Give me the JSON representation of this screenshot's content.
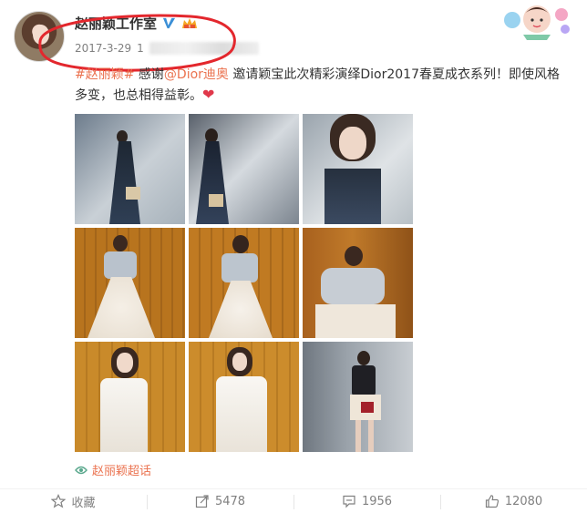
{
  "post": {
    "author": "赵丽颖工作室",
    "date": "2017-3-29",
    "time_fragment": "1",
    "text": {
      "hashtag": "#赵丽颖#",
      "part1": " 感谢",
      "mention": "@Dior迪奥",
      "part2": " 邀请颖宝此次精彩演绎Dior2017春夏成衣系列！即使风格多变，也总相得益彰。"
    },
    "topic_label": "赵丽颖超话"
  },
  "actions": {
    "collect": "收藏",
    "forward": "5478",
    "comment": "1956",
    "like": "12080"
  },
  "icons": [
    "verified-v-icon",
    "vip-badge-icon",
    "star-icon",
    "forward-icon",
    "comment-icon",
    "like-icon",
    "topic-icon"
  ],
  "colors": {
    "link": "#eb7350",
    "verified": "#3b8fd6",
    "annotation": "#e3272d",
    "heart": "#e0384a"
  }
}
